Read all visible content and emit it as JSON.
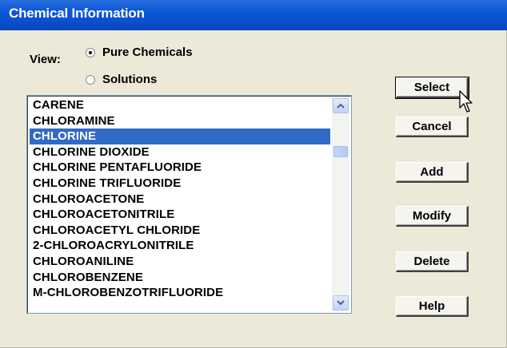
{
  "window": {
    "title": "Chemical Information"
  },
  "view": {
    "label": "View:",
    "options": [
      {
        "label": "Pure Chemicals",
        "selected": true
      },
      {
        "label": "Solutions",
        "selected": false
      }
    ]
  },
  "chemical_list": {
    "items": [
      "CARENE",
      "CHLORAMINE",
      "CHLORINE",
      "CHLORINE DIOXIDE",
      "CHLORINE PENTAFLUORIDE",
      "CHLORINE TRIFLUORIDE",
      "CHLOROACETONE",
      "CHLOROACETONITRILE",
      "CHLOROACETYL CHLORIDE",
      "2-CHLOROACRYLONITRILE",
      "CHLOROANILINE",
      "CHLOROBENZENE",
      "M-CHLOROBENZOTRIFLUORIDE"
    ],
    "selected_item": "CHLORINE"
  },
  "buttons": {
    "select": "Select",
    "cancel": "Cancel",
    "add": "Add",
    "modify": "Modify",
    "delete": "Delete",
    "help": "Help"
  },
  "colors": {
    "titlebar": "#0a4fcf",
    "selection": "#316ac5",
    "dialog_bg": "#ece9d8"
  },
  "icons": {
    "scroll_up": "chevron-up-icon",
    "scroll_down": "chevron-down-icon",
    "cursor": "mouse-pointer-icon"
  }
}
